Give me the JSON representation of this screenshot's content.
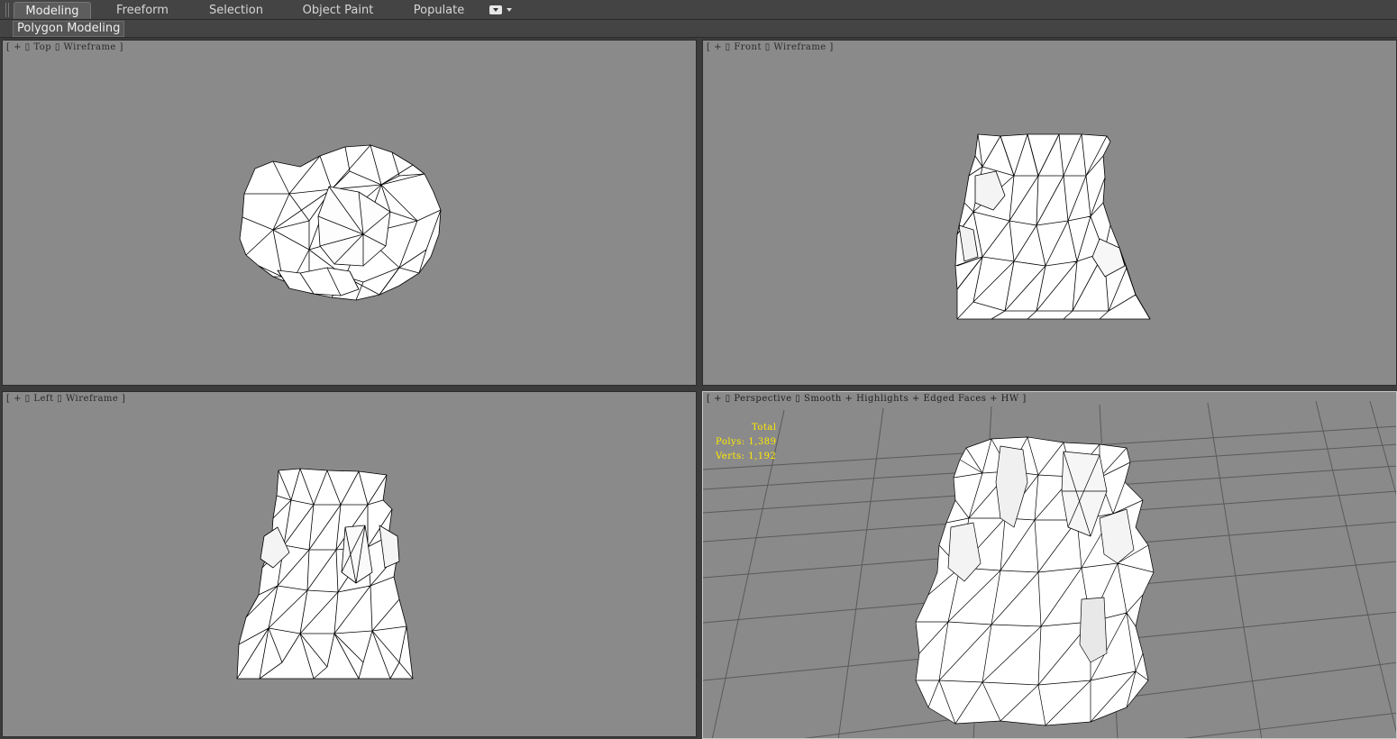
{
  "ribbon": {
    "tabs": [
      "Modeling",
      "Freeform",
      "Selection",
      "Object Paint",
      "Populate"
    ],
    "active_tab": "Modeling"
  },
  "subribbon": {
    "panel_label": "Polygon Modeling"
  },
  "viewports": {
    "top": {
      "label": "[ + ▯ Top ▯ Wireframe ]"
    },
    "front": {
      "label": "[ + ▯ Front ▯ Wireframe ]"
    },
    "left": {
      "label": "[ + ▯ Left ▯ Wireframe ]"
    },
    "perspective": {
      "label": "[ + ▯ Perspective ▯ Smooth + Highlights + Edged Faces + HW ]"
    }
  },
  "stats": {
    "title": "Total",
    "polys": "Polys: 1,389",
    "verts": "Verts: 1,192"
  },
  "colors": {
    "viewport_bg": "#8a8a8a",
    "ui_bg": "#444444",
    "stats_text": "#ffea00",
    "mesh_fill": "#ffffff",
    "mesh_edge": "#000000"
  }
}
